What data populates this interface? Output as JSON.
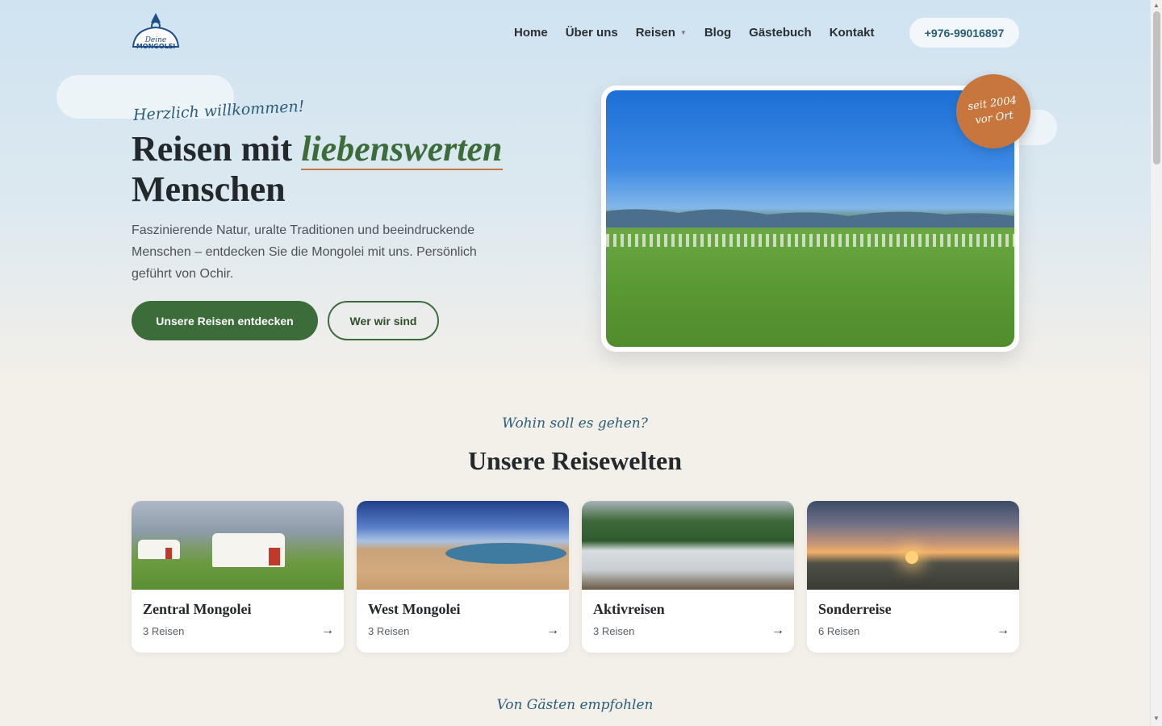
{
  "header": {
    "logo_text": "Deine MONGOLEI",
    "nav": [
      {
        "label": "Home"
      },
      {
        "label": "Über uns"
      },
      {
        "label": "Reisen"
      },
      {
        "label": "Blog"
      },
      {
        "label": "Gästebuch"
      },
      {
        "label": "Kontakt"
      }
    ],
    "phone": "+976-99016897"
  },
  "hero": {
    "greeting": "Herzlich willkommen!",
    "title_part1": "Reisen mit ",
    "title_accent": "liebenswerten",
    "title_part2": "Menschen",
    "lead": "Faszinierende Natur, uralte Traditionen und beeindruckende Menschen – entdecken Sie die Mongolei mit uns. Persönlich geführt von Ochir.",
    "primary_button": "Unsere Reisen entdecken",
    "secondary_button": "Wer wir sind",
    "badge_line1": "seit 2004",
    "badge_line2": "vor Ort"
  },
  "destinations": {
    "kicker": "Wohin soll es gehen?",
    "title": "Unsere Reisewelten",
    "cards": [
      {
        "title": "Zentral Mongolei",
        "count": "3 Reisen"
      },
      {
        "title": "West Mongolei",
        "count": "3 Reisen"
      },
      {
        "title": "Aktivreisen",
        "count": "3 Reisen"
      },
      {
        "title": "Sonderreise",
        "count": "6 Reisen"
      }
    ],
    "arrow": "→"
  },
  "testimonials": {
    "kicker": "Von Gästen empfohlen"
  },
  "colors": {
    "primary_green": "#3c6c3a",
    "accent_orange": "#c7763d",
    "script_blue": "#2b5d78",
    "background": "#f3efe9"
  }
}
